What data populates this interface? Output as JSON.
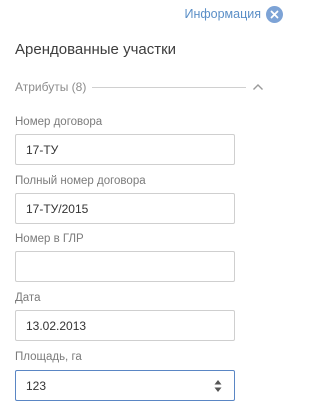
{
  "header": {
    "link_label": "Информация",
    "close_icon": "close-icon"
  },
  "panel": {
    "title": "Арендованные участки"
  },
  "section": {
    "label": "Атрибуты (8)",
    "chevron_icon": "chevron-up-icon"
  },
  "fields": [
    {
      "label": "Номер договора",
      "value": "17-ТУ"
    },
    {
      "label": "Полный номер договора",
      "value": "17-ТУ/2015"
    },
    {
      "label": "Номер в ГЛР",
      "value": ""
    },
    {
      "label": "Дата",
      "value": "13.02.2013"
    },
    {
      "label": "Площадь, га",
      "value": "123",
      "control": "number-stepper"
    }
  ],
  "colors": {
    "accent": "#5b8fc7",
    "close_bg": "#7da3d6",
    "focus_border": "#5a86c4"
  }
}
